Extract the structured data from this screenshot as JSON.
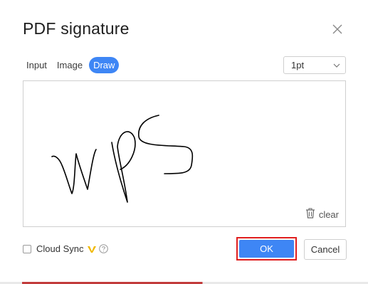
{
  "dialog": {
    "title": "PDF signature"
  },
  "tabs": [
    {
      "label": "Input",
      "active": false
    },
    {
      "label": "Image",
      "active": false
    },
    {
      "label": "Draw",
      "active": true
    }
  ],
  "pen_width": {
    "selected": "1pt"
  },
  "canvas": {
    "clear_label": "clear",
    "signature_text": "WPS"
  },
  "footer": {
    "cloud_sync_label": "Cloud Sync",
    "cloud_sync_checked": false,
    "ok_label": "OK",
    "cancel_label": "Cancel"
  },
  "colors": {
    "accent": "#3e86f5",
    "highlight": "#e01e1e",
    "vip": "#f0b800"
  },
  "icons": {
    "close": "close-icon",
    "dropdown": "chevron-down-icon",
    "clear": "trash-icon",
    "vip": "vip-badge-icon",
    "help": "help-icon"
  }
}
